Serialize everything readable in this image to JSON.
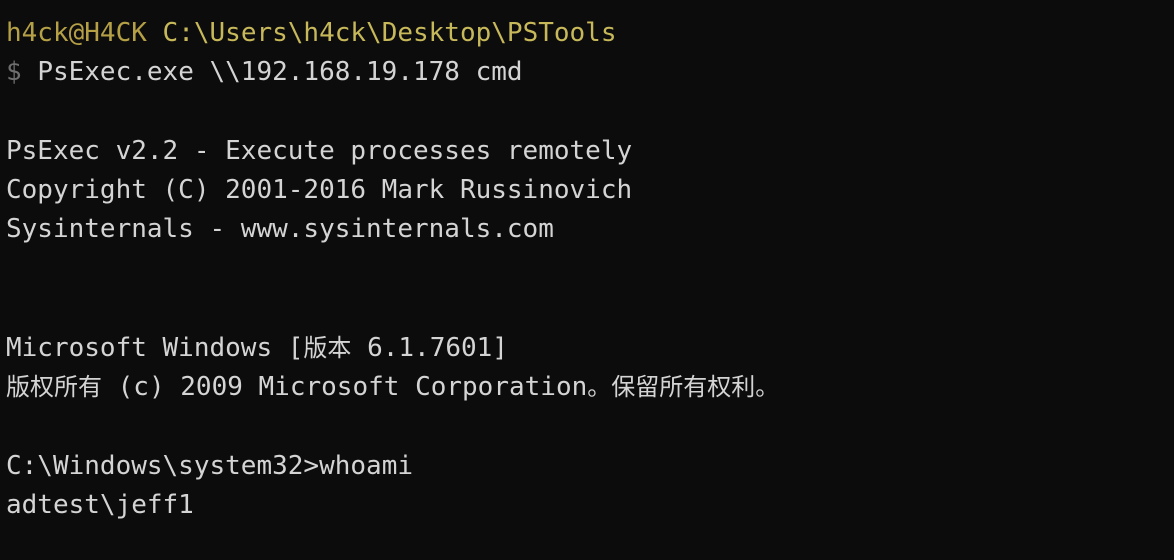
{
  "prompt": {
    "user_host": "h4ck@H4CK",
    "path": "C:\\Users\\h4ck\\Desktop\\PSTools",
    "dollar": "$",
    "command": "PsExec.exe \\\\192.168.19.178 cmd"
  },
  "output": {
    "banner_line1": "PsExec v2.2 - Execute processes remotely",
    "banner_line2": "Copyright (C) 2001-2016 Mark Russinovich",
    "banner_line3": "Sysinternals - www.sysinternals.com",
    "windows_line_a": "Microsoft Windows [",
    "windows_line_cjk": "版本",
    "windows_line_b": " 6.1.7601]",
    "copyright_cjk_a": "版权所有",
    "copyright_mid": " (c) 2009 Microsoft Corporation",
    "copyright_cjk_b": "。保留所有权利。",
    "remote_prompt": "C:\\Windows\\system32>",
    "remote_command": "whoami",
    "whoami_result": "adtest\\jeff1"
  },
  "colors": {
    "background": "#0c0c0c",
    "text": "#d4d4d4",
    "prompt_user": "#b5a046",
    "prompt_path": "#c7b85a",
    "dollar": "#6e6e6e"
  }
}
